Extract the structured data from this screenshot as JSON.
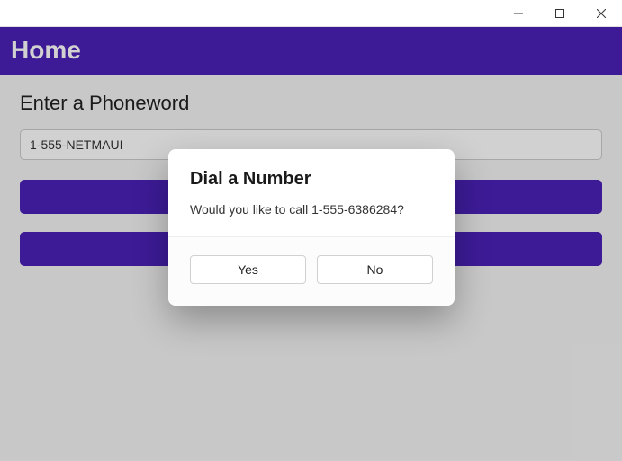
{
  "window": {
    "minimize_title": "Minimize",
    "maximize_title": "Maximize",
    "close_title": "Close"
  },
  "header": {
    "title": "Home"
  },
  "main": {
    "label": "Enter a Phoneword",
    "input_value": "1-555-NETMAUI",
    "translate_label": "",
    "call_label": ""
  },
  "dialog": {
    "title": "Dial a Number",
    "message": "Would you like to call 1-555-6386284?",
    "yes": "Yes",
    "no": "No"
  },
  "colors": {
    "accent": "#4b22b9"
  }
}
